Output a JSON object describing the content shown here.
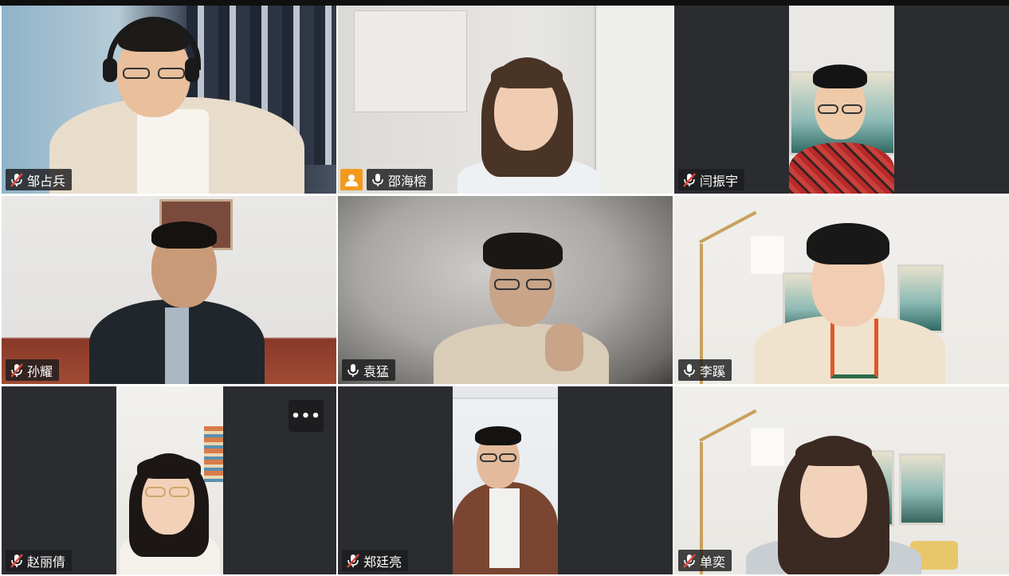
{
  "window": {
    "title": ""
  },
  "participants": [
    {
      "name": "邹占兵",
      "muted": true,
      "host": false,
      "active": false
    },
    {
      "name": "邵海榕",
      "muted": false,
      "host": true,
      "active": false
    },
    {
      "name": "闫振宇",
      "muted": true,
      "host": false,
      "active": false
    },
    {
      "name": "孙耀",
      "muted": true,
      "host": false,
      "active": false
    },
    {
      "name": "袁猛",
      "muted": false,
      "host": false,
      "active": false
    },
    {
      "name": "李蹊",
      "muted": false,
      "host": false,
      "active": true
    },
    {
      "name": "赵丽倩",
      "muted": true,
      "host": false,
      "active": false
    },
    {
      "name": "郑廷亮",
      "muted": true,
      "host": false,
      "active": false
    },
    {
      "name": "单奕",
      "muted": true,
      "host": false,
      "active": false
    }
  ],
  "more_button": {
    "label": "•••"
  },
  "colors": {
    "active_border": "#1ec36b",
    "host_badge": "#f39a1c",
    "muted_slash": "#e0453b",
    "tile_bg": "#2b2c2f"
  },
  "icons": {
    "muted": "mic-muted-icon",
    "unmuted": "mic-icon",
    "host": "host-person-icon",
    "more": "more-options-icon"
  }
}
